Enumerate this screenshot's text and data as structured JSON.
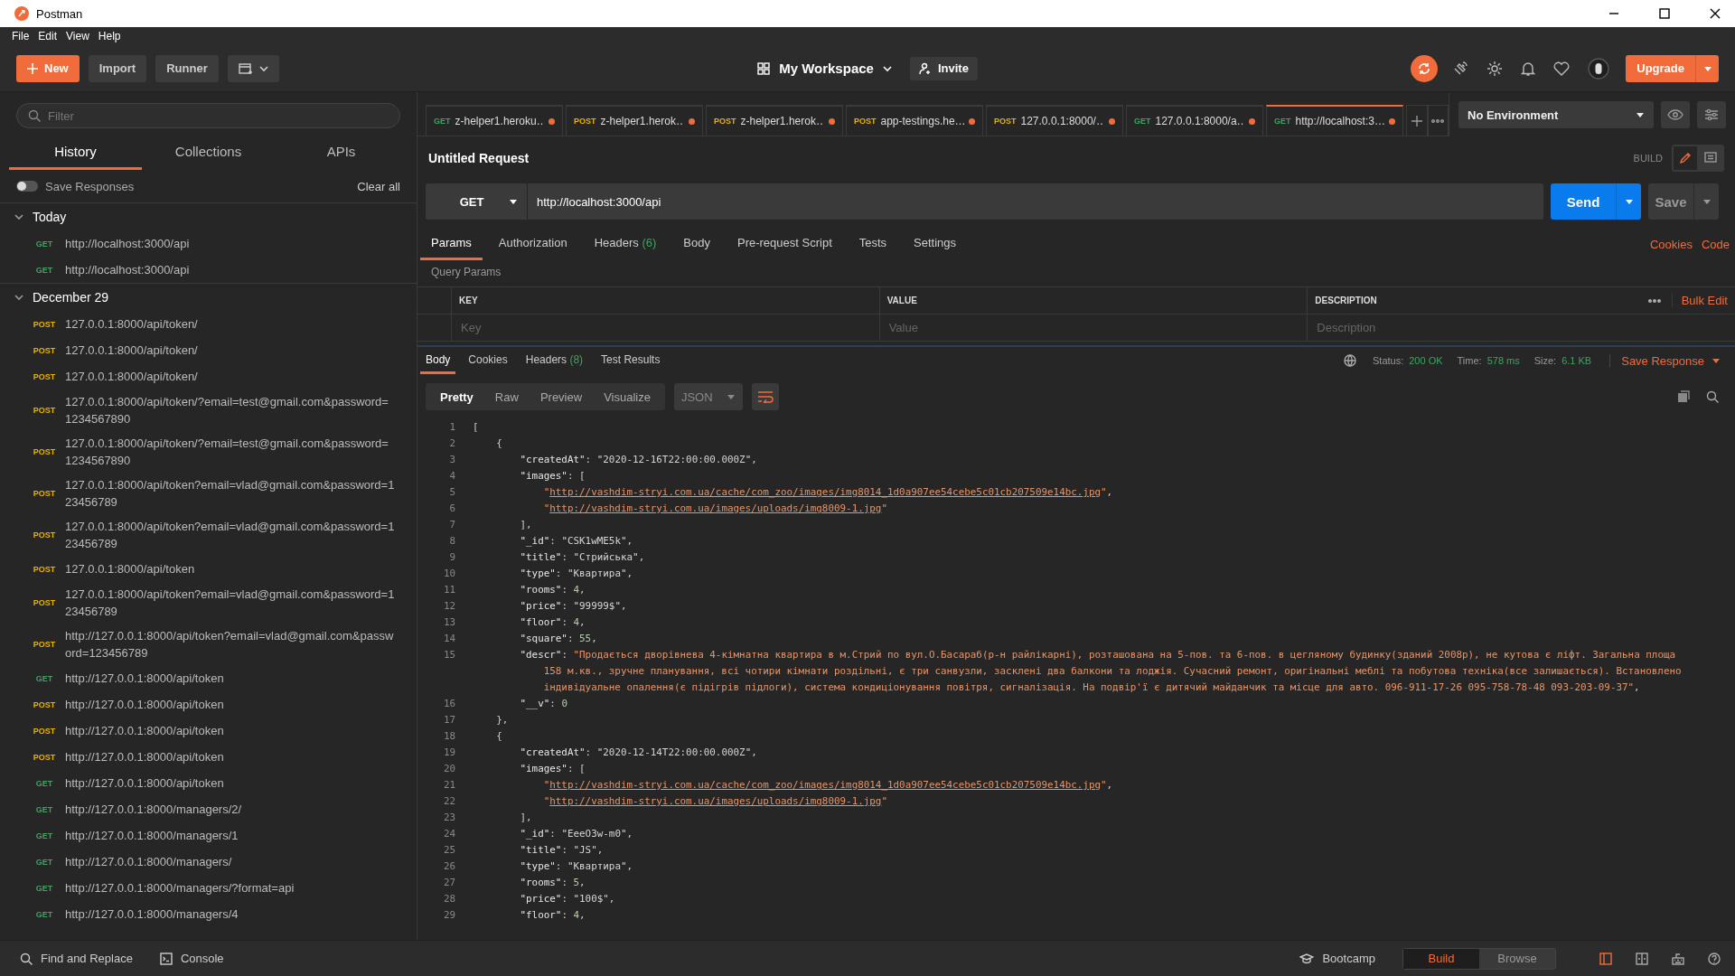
{
  "window": {
    "title": "Postman",
    "menu": [
      "File",
      "Edit",
      "View",
      "Help"
    ]
  },
  "header": {
    "new_button": "New",
    "import_button": "Import",
    "runner_button": "Runner",
    "workspace": "My Workspace",
    "invite_button": "Invite",
    "upgrade_button": "Upgrade"
  },
  "sidebar": {
    "filter": {
      "placeholder": "Filter"
    },
    "tabs": [
      {
        "label": "History",
        "selected": true
      },
      {
        "label": "Collections",
        "selected": false
      },
      {
        "label": "APIs",
        "selected": false
      }
    ],
    "save_responses": {
      "label": "Save Responses",
      "on": false
    },
    "clear_all": "Clear all",
    "groups": [
      {
        "title": "Today",
        "expanded": true,
        "items": [
          {
            "method": "GET",
            "color": "#3fa35f",
            "url": "http://localhost:3000/api"
          },
          {
            "method": "GET",
            "color": "#3fa35f",
            "url": "http://localhost:3000/api"
          }
        ]
      },
      {
        "title": "December 29",
        "expanded": true,
        "items": [
          {
            "method": "POST",
            "color": "#e5b300",
            "url": "127.0.0.1:8000/api/token/"
          },
          {
            "method": "POST",
            "color": "#e5b300",
            "url": "127.0.0.1:8000/api/token/"
          },
          {
            "method": "POST",
            "color": "#e5b300",
            "url": "127.0.0.1:8000/api/token/"
          },
          {
            "method": "POST",
            "color": "#e5b300",
            "url": "127.0.0.1:8000/api/token/?email=test@gmail.com&password=1234567890"
          },
          {
            "method": "POST",
            "color": "#e5b300",
            "url": "127.0.0.1:8000/api/token/?email=test@gmail.com&password=1234567890"
          },
          {
            "method": "POST",
            "color": "#e5b300",
            "url": "127.0.0.1:8000/api/token?email=vlad@gmail.com&password=123456789"
          },
          {
            "method": "POST",
            "color": "#e5b300",
            "url": "127.0.0.1:8000/api/token?email=vlad@gmail.com&password=123456789"
          },
          {
            "method": "POST",
            "color": "#e5b300",
            "url": "127.0.0.1:8000/api/token"
          },
          {
            "method": "POST",
            "color": "#e5b300",
            "url": "127.0.0.1:8000/api/token?email=vlad@gmail.com&password=123456789"
          },
          {
            "method": "POST",
            "color": "#e5b300",
            "url": "http://127.0.0.1:8000/api/token?email=vlad@gmail.com&password=123456789"
          },
          {
            "method": "GET",
            "color": "#3fa35f",
            "url": "http://127.0.0.1:8000/api/token"
          },
          {
            "method": "POST",
            "color": "#e5b300",
            "url": "http://127.0.0.1:8000/api/token"
          },
          {
            "method": "POST",
            "color": "#e5b300",
            "url": "http://127.0.0.1:8000/api/token"
          },
          {
            "method": "POST",
            "color": "#e5b300",
            "url": "http://127.0.0.1:8000/api/token"
          },
          {
            "method": "GET",
            "color": "#3fa35f",
            "url": "http://127.0.0.1:8000/api/token"
          },
          {
            "method": "GET",
            "color": "#3fa35f",
            "url": "http://127.0.0.1:8000/managers/2/"
          },
          {
            "method": "GET",
            "color": "#3fa35f",
            "url": "http://127.0.0.1:8000/managers/1"
          },
          {
            "method": "GET",
            "color": "#3fa35f",
            "url": "http://127.0.0.1:8000/managers/"
          },
          {
            "method": "GET",
            "color": "#3fa35f",
            "url": "http://127.0.0.1:8000/managers/?format=api"
          },
          {
            "method": "GET",
            "color": "#3fa35f",
            "url": "http://127.0.0.1:8000/managers/4"
          }
        ]
      }
    ]
  },
  "request_tabs": [
    {
      "method": "GET",
      "color": "#3fa35f",
      "title": "z-helper1.heroku…",
      "unsaved": true,
      "selected": false
    },
    {
      "method": "POST",
      "color": "#e5b300",
      "title": "z-helper1.herok…",
      "unsaved": true,
      "selected": false
    },
    {
      "method": "POST",
      "color": "#e5b300",
      "title": "z-helper1.herok…",
      "unsaved": true,
      "selected": false
    },
    {
      "method": "POST",
      "color": "#e5b300",
      "title": "app-testings.he…",
      "unsaved": true,
      "selected": false
    },
    {
      "method": "POST",
      "color": "#e5b300",
      "title": "127.0.0.1:8000/…",
      "unsaved": true,
      "selected": false
    },
    {
      "method": "GET",
      "color": "#3fa35f",
      "title": "127.0.0.1:8000/a…",
      "unsaved": true,
      "selected": false
    },
    {
      "method": "GET",
      "color": "#3fa35f",
      "title": "http://localhost:3…",
      "unsaved": true,
      "selected": true
    }
  ],
  "environment": {
    "value": "No Environment"
  },
  "request": {
    "title": "Untitled Request",
    "mode_label": "BUILD",
    "method": "GET",
    "url": "http://localhost:3000/api",
    "send_button": "Send",
    "save_button": "Save",
    "tabs": [
      {
        "label": "Params",
        "selected": true
      },
      {
        "label": "Authorization",
        "selected": false
      },
      {
        "label": "Headers",
        "count": "(6)",
        "selected": false
      },
      {
        "label": "Body",
        "selected": false
      },
      {
        "label": "Pre-request Script",
        "selected": false
      },
      {
        "label": "Tests",
        "selected": false
      },
      {
        "label": "Settings",
        "selected": false
      }
    ],
    "links": [
      "Cookies",
      "Code"
    ],
    "query_params": {
      "title": "Query Params",
      "columns": [
        "KEY",
        "VALUE",
        "DESCRIPTION"
      ],
      "bulk_edit": "Bulk Edit",
      "placeholders": [
        "Key",
        "Value",
        "Description"
      ]
    }
  },
  "response": {
    "tabs": [
      {
        "label": "Body",
        "selected": true
      },
      {
        "label": "Cookies",
        "selected": false
      },
      {
        "label": "Headers",
        "count": "(8)",
        "selected": false
      },
      {
        "label": "Test Results",
        "selected": false
      }
    ],
    "status": [
      {
        "label": "Status:",
        "value": "200 OK"
      },
      {
        "label": "Time:",
        "value": "578 ms"
      },
      {
        "label": "Size:",
        "value": "6.1 KB"
      }
    ],
    "save_response": "Save Response",
    "views": [
      {
        "label": "Pretty",
        "selected": true
      },
      {
        "label": "Raw",
        "selected": false
      },
      {
        "label": "Preview",
        "selected": false
      },
      {
        "label": "Visualize",
        "selected": false
      }
    ],
    "format": "JSON",
    "wrap_lines": true,
    "lines": [
      {
        "number": "1",
        "tokens": [
          {
            "kind": "punct",
            "text": "["
          }
        ]
      },
      {
        "number": "2",
        "tokens": [
          {
            "kind": "punct",
            "text": "    {"
          }
        ]
      },
      {
        "number": "3",
        "tokens": [
          {
            "kind": "key",
            "text": "        \"createdAt\""
          },
          {
            "kind": "punct",
            "text": ": "
          },
          {
            "kind": "value",
            "text": "\"2020-12-16T22:00:00.000Z\""
          },
          {
            "kind": "punct",
            "text": ","
          }
        ]
      },
      {
        "number": "4",
        "tokens": [
          {
            "kind": "key",
            "text": "        \"images\""
          },
          {
            "kind": "punct",
            "text": ": ["
          }
        ]
      },
      {
        "number": "5",
        "tokens": [
          {
            "kind": "text",
            "text": "            \""
          },
          {
            "kind": "link",
            "text": "http://vashdim-stryi.com.ua/cache/com_zoo/images/img8014_1d0a907ee54cebe5c01cb207509e14bc.jpg"
          },
          {
            "kind": "text",
            "text": "\""
          },
          {
            "kind": "punct",
            "text": ","
          }
        ]
      },
      {
        "number": "6",
        "tokens": [
          {
            "kind": "text",
            "text": "            \""
          },
          {
            "kind": "link",
            "text": "http://vashdim-stryi.com.ua/images/uploads/img8009-1.jpg"
          },
          {
            "kind": "text",
            "text": "\""
          }
        ]
      },
      {
        "number": "7",
        "tokens": [
          {
            "kind": "punct",
            "text": "        ],"
          }
        ]
      },
      {
        "number": "8",
        "tokens": [
          {
            "kind": "key",
            "text": "        \"_id\""
          },
          {
            "kind": "punct",
            "text": ": "
          },
          {
            "kind": "value",
            "text": "\"CSK1wME5k\""
          },
          {
            "kind": "punct",
            "text": ","
          }
        ]
      },
      {
        "number": "9",
        "tokens": [
          {
            "kind": "key",
            "text": "        \"title\""
          },
          {
            "kind": "punct",
            "text": ": "
          },
          {
            "kind": "value",
            "text": "\"Стрийська\""
          },
          {
            "kind": "punct",
            "text": ","
          }
        ]
      },
      {
        "number": "10",
        "tokens": [
          {
            "kind": "key",
            "text": "        \"type\""
          },
          {
            "kind": "punct",
            "text": ": "
          },
          {
            "kind": "value",
            "text": "\"Квартира\""
          },
          {
            "kind": "punct",
            "text": ","
          }
        ]
      },
      {
        "number": "11",
        "tokens": [
          {
            "kind": "key",
            "text": "        \"rooms\""
          },
          {
            "kind": "punct",
            "text": ": "
          },
          {
            "kind": "number",
            "text": "4"
          },
          {
            "kind": "punct",
            "text": ","
          }
        ]
      },
      {
        "number": "12",
        "tokens": [
          {
            "kind": "key",
            "text": "        \"price\""
          },
          {
            "kind": "punct",
            "text": ": "
          },
          {
            "kind": "value",
            "text": "\"99999$\""
          },
          {
            "kind": "punct",
            "text": ","
          }
        ]
      },
      {
        "number": "13",
        "tokens": [
          {
            "kind": "key",
            "text": "        \"floor\""
          },
          {
            "kind": "punct",
            "text": ": "
          },
          {
            "kind": "number",
            "text": "4"
          },
          {
            "kind": "punct",
            "text": ","
          }
        ]
      },
      {
        "number": "14",
        "tokens": [
          {
            "kind": "key",
            "text": "        \"square\""
          },
          {
            "kind": "punct",
            "text": ": "
          },
          {
            "kind": "number",
            "text": "55"
          },
          {
            "kind": "punct",
            "text": ","
          }
        ]
      },
      {
        "number": "15",
        "tokens": [
          {
            "kind": "key",
            "text": "        \"descr\""
          },
          {
            "kind": "punct",
            "text": ": "
          },
          {
            "kind": "text",
            "text": "\"Продається дворівнева 4-кімнатна квартира в м.Стрий по вул.О.Басараб(р-н райлікарні), розташована на 5-пов. та 6-пов. в цегляному будинку(зданий 2008р), не кутова є ліфт. Загальна площа 158 м.кв., зручне планування, всі чотири кімнати роздільні, є три санвузли, засклені два балкони та лоджія. Сучасний ремонт, оригінальні меблі та побутова техніка(все залишається). Встановлено індивідуальне опалення(є підігрів підлоги), система кондиціонування повітря, сигналізація. На подвір'ї є дитячий майданчик та місце для авто. 096-911-17-26 095-758-78-48 093-203-09-37\""
          },
          {
            "kind": "punct",
            "text": ","
          }
        ]
      },
      {
        "number": "16",
        "tokens": [
          {
            "kind": "key",
            "text": "        \"__v\""
          },
          {
            "kind": "punct",
            "text": ": "
          },
          {
            "kind": "number",
            "text": "0"
          }
        ]
      },
      {
        "number": "17",
        "tokens": [
          {
            "kind": "punct",
            "text": "    },"
          }
        ]
      },
      {
        "number": "18",
        "tokens": [
          {
            "kind": "punct",
            "text": "    {"
          }
        ]
      },
      {
        "number": "19",
        "tokens": [
          {
            "kind": "key",
            "text": "        \"createdAt\""
          },
          {
            "kind": "punct",
            "text": ": "
          },
          {
            "kind": "value",
            "text": "\"2020-12-14T22:00:00.000Z\""
          },
          {
            "kind": "punct",
            "text": ","
          }
        ]
      },
      {
        "number": "20",
        "tokens": [
          {
            "kind": "key",
            "text": "        \"images\""
          },
          {
            "kind": "punct",
            "text": ": ["
          }
        ]
      },
      {
        "number": "21",
        "tokens": [
          {
            "kind": "text",
            "text": "            \""
          },
          {
            "kind": "link",
            "text": "http://vashdim-stryi.com.ua/cache/com_zoo/images/img8014_1d0a907ee54cebe5c01cb207509e14bc.jpg"
          },
          {
            "kind": "text",
            "text": "\""
          },
          {
            "kind": "punct",
            "text": ","
          }
        ]
      },
      {
        "number": "22",
        "tokens": [
          {
            "kind": "text",
            "text": "            \""
          },
          {
            "kind": "link",
            "text": "http://vashdim-stryi.com.ua/images/uploads/img8009-1.jpg"
          },
          {
            "kind": "text",
            "text": "\""
          }
        ]
      },
      {
        "number": "23",
        "tokens": [
          {
            "kind": "punct",
            "text": "        ],"
          }
        ]
      },
      {
        "number": "24",
        "tokens": [
          {
            "kind": "key",
            "text": "        \"_id\""
          },
          {
            "kind": "punct",
            "text": ": "
          },
          {
            "kind": "value",
            "text": "\"EeeO3w-m0\""
          },
          {
            "kind": "punct",
            "text": ","
          }
        ]
      },
      {
        "number": "25",
        "tokens": [
          {
            "kind": "key",
            "text": "        \"title\""
          },
          {
            "kind": "punct",
            "text": ": "
          },
          {
            "kind": "value",
            "text": "\"JS\""
          },
          {
            "kind": "punct",
            "text": ","
          }
        ]
      },
      {
        "number": "26",
        "tokens": [
          {
            "kind": "key",
            "text": "        \"type\""
          },
          {
            "kind": "punct",
            "text": ": "
          },
          {
            "kind": "value",
            "text": "\"Квартира\""
          },
          {
            "kind": "punct",
            "text": ","
          }
        ]
      },
      {
        "number": "27",
        "tokens": [
          {
            "kind": "key",
            "text": "        \"rooms\""
          },
          {
            "kind": "punct",
            "text": ": "
          },
          {
            "kind": "number",
            "text": "5"
          },
          {
            "kind": "punct",
            "text": ","
          }
        ]
      },
      {
        "number": "28",
        "tokens": [
          {
            "kind": "key",
            "text": "        \"price\""
          },
          {
            "kind": "punct",
            "text": ": "
          },
          {
            "kind": "value",
            "text": "\"100$\""
          },
          {
            "kind": "punct",
            "text": ","
          }
        ]
      },
      {
        "number": "29",
        "tokens": [
          {
            "kind": "key",
            "text": "        \"floor\""
          },
          {
            "kind": "punct",
            "text": ": "
          },
          {
            "kind": "number",
            "text": "4"
          },
          {
            "kind": "punct",
            "text": ","
          }
        ]
      }
    ]
  },
  "footer": {
    "find_replace": "Find and Replace",
    "console": "Console",
    "bootcamp": "Bootcamp",
    "modes": [
      {
        "label": "Build",
        "selected": true
      },
      {
        "label": "Browse",
        "selected": false
      }
    ]
  }
}
